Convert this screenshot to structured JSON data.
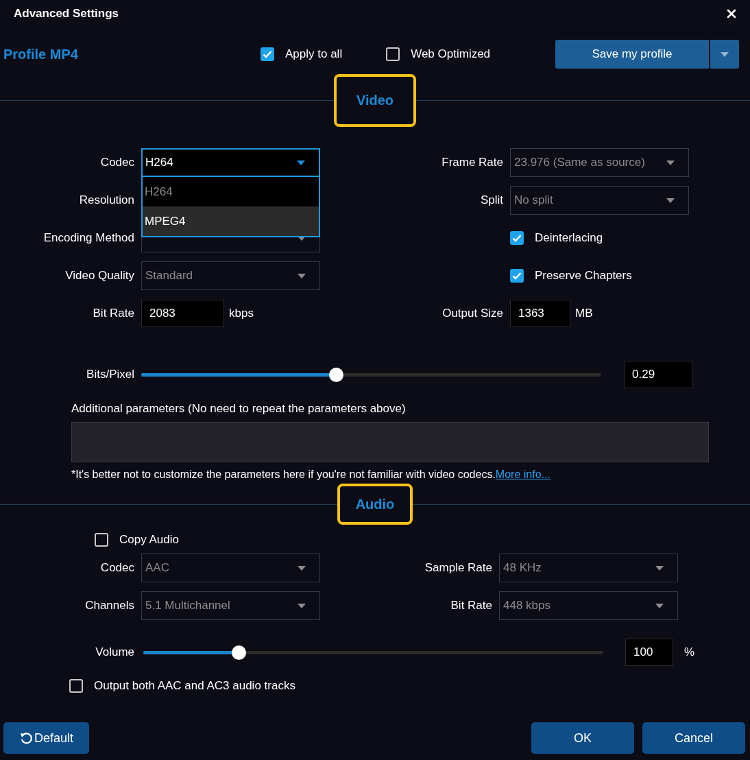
{
  "window": {
    "title": "Advanced Settings"
  },
  "profile": {
    "title": "Profile MP4"
  },
  "options": [
    {
      "label": "Apply to all",
      "checked": true
    },
    {
      "label": "Web Optimized",
      "checked": false
    }
  ],
  "save_button": {
    "label": "Save my profile"
  },
  "video": {
    "heading": "Video",
    "highlighted": true,
    "rows": [
      {
        "left": {
          "kind": "select",
          "label": "Codec",
          "value": "H264",
          "disabled": false,
          "open": true,
          "options": [
            {
              "label": "H264",
              "highlighted": false
            },
            {
              "label": "MPEG4",
              "highlighted": true
            }
          ]
        },
        "right": {
          "kind": "select",
          "label": "Frame Rate",
          "value": "23.976 (Same as source)",
          "disabled": true
        }
      },
      {
        "left": {
          "kind": "select",
          "label": "Resolution"
        },
        "right": {
          "kind": "select",
          "label": "Split",
          "value": "No split",
          "disabled": true
        }
      },
      {
        "left": {
          "kind": "select",
          "label": "Encoding Method",
          "disabled": true
        },
        "right": {
          "kind": "checkbox",
          "label": "Deinterlacing",
          "checked": true
        }
      },
      {
        "left": {
          "kind": "select",
          "label": "Video Quality",
          "value": "Standard",
          "disabled": true
        },
        "right": {
          "kind": "checkbox",
          "label": "Preserve Chapters",
          "checked": true
        }
      },
      {
        "left": {
          "kind": "number",
          "label": "Bit Rate",
          "value": "2083",
          "unit": "kbps"
        },
        "right": {
          "kind": "number",
          "label": "Output Size",
          "value": "1363",
          "unit": "MB"
        }
      }
    ],
    "bits_pixel": {
      "label": "Bits/Pixel",
      "level": 0.43,
      "value": "0.29"
    },
    "additional": {
      "label": "Additional parameters (No need to repeat the parameters above)",
      "note": "*It's better not to customize the parameters here if you're not familiar with video codecs.",
      "link": "More info..."
    }
  },
  "audio": {
    "heading": "Audio",
    "highlighted": true,
    "copy_audio": {
      "label": "Copy Audio",
      "checked": false
    },
    "rows": [
      {
        "left": {
          "kind": "select",
          "label": "Codec",
          "value": "AAC",
          "disabled": true
        },
        "right": {
          "kind": "select",
          "label": "Sample Rate",
          "value": "48 KHz",
          "disabled": true
        }
      },
      {
        "left": {
          "kind": "select",
          "label": "Channels",
          "value": "5.1 Multichannel",
          "disabled": true
        },
        "right": {
          "kind": "select",
          "label": "Bit Rate",
          "value": "448 kbps",
          "disabled": true
        }
      }
    ],
    "volume": {
      "label": "Volume",
      "level": 0.21,
      "value": "100",
      "unit": "%"
    },
    "output_both": {
      "label": "Output both AAC and AC3 audio tracks",
      "checked": false
    }
  },
  "buttons": {
    "default": "Default",
    "ok": "OK",
    "cancel": "Cancel"
  }
}
